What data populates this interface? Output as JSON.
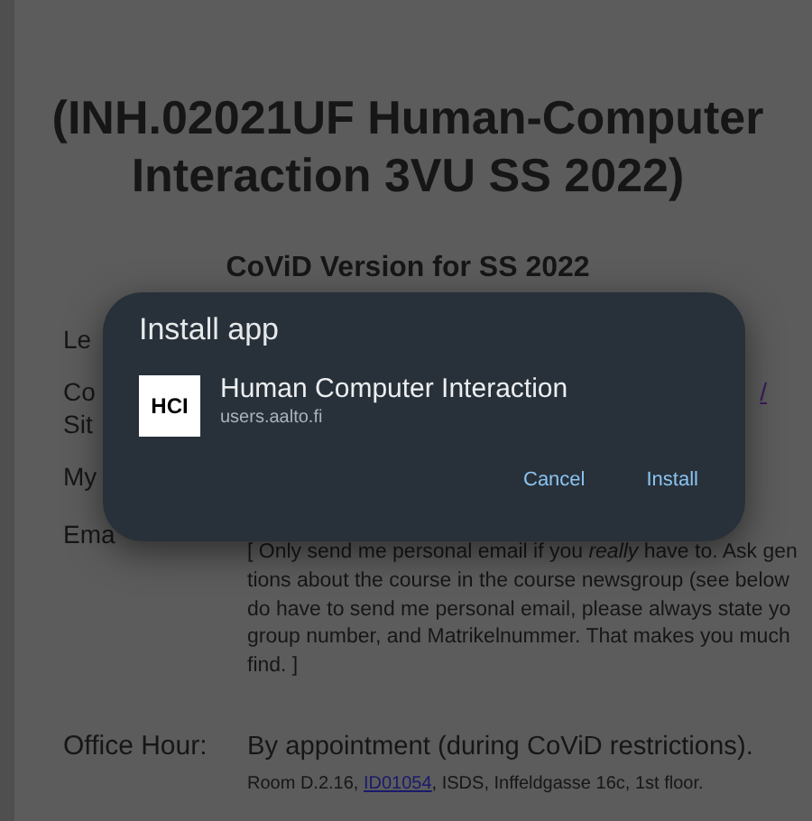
{
  "page": {
    "heading": "(INH.02021UF Human-Computer\nInteraction 3VU SS 2022)",
    "subtitle": "CoViD Version for SS 2022",
    "rows": [
      {
        "label": "Le"
      },
      {
        "label": "Co\nSit",
        "link": "/"
      },
      {
        "label": "My"
      }
    ],
    "email": {
      "label": "Ema",
      "note_before": "[ Only send me personal email if you ",
      "note_italic": "really",
      "note_after": " have to. Ask gen\ntions about the course in the course newsgroup (see below\ndo have to send me personal email, please always state yo\ngroup number, and Matrikelnummer. That makes you much\nfind. ]"
    },
    "office": {
      "label": "Office Hour:",
      "value": "By appointment (during CoViD restrictions).",
      "room_before": "Room D.2.16, ",
      "room_link": "ID01054",
      "room_after": ", ISDS, Inffeldgasse 16c, 1st floor."
    }
  },
  "dialog": {
    "title": "Install app",
    "app_icon_text": "HCI",
    "app_name": "Human Computer Interaction",
    "app_host": "users.aalto.fi",
    "buttons": [
      "Cancel",
      "Install"
    ]
  }
}
